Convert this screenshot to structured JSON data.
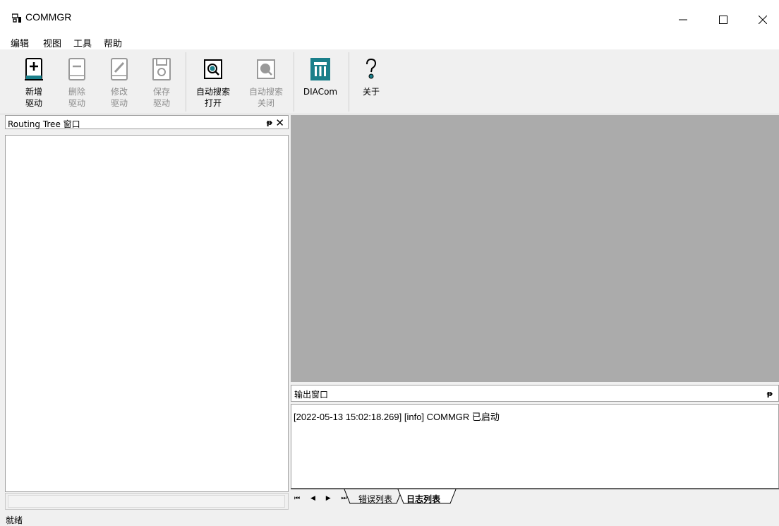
{
  "app": {
    "title": "COMMGR",
    "icon": "app-icon",
    "window_controls": {
      "minimize": "—",
      "maximize": "☐",
      "close": "✕"
    }
  },
  "menu": {
    "items": [
      "编辑",
      "视图",
      "工具",
      "帮助"
    ]
  },
  "toolbar": {
    "buttons": [
      {
        "line1": "新增",
        "line2": "驱动",
        "icon": "add-driver-icon",
        "enabled": true
      },
      {
        "line1": "删除",
        "line2": "驱动",
        "icon": "delete-driver-icon",
        "enabled": false
      },
      {
        "line1": "修改",
        "line2": "驱动",
        "icon": "edit-driver-icon",
        "enabled": false
      },
      {
        "line1": "保存",
        "line2": "驱动",
        "icon": "save-driver-icon",
        "enabled": false
      },
      {
        "line1": "自动搜索",
        "line2": "打开",
        "icon": "auto-search-open-icon",
        "enabled": true
      },
      {
        "line1": "自动搜索",
        "line2": "关闭",
        "icon": "auto-search-close-icon",
        "enabled": false
      },
      {
        "line1": "DIACom",
        "line2": "",
        "icon": "diacom-icon",
        "enabled": true
      },
      {
        "line1": "关于",
        "line2": "",
        "icon": "about-icon",
        "enabled": true
      }
    ],
    "accent": "#1a7f8a"
  },
  "routing_panel": {
    "title": "Routing Tree 窗口",
    "pin": "ᵽ",
    "close": "✕"
  },
  "output_panel": {
    "title": "输出窗口",
    "pin": "ᵽ",
    "log": [
      "[2022-05-13 15:02:18.269] [info] COMMGR 已启动"
    ],
    "nav": "⏮ ◀ ▶ ⏭",
    "tabs": [
      {
        "label": "错误列表",
        "active": false
      },
      {
        "label": "日志列表",
        "active": true
      }
    ]
  },
  "status": {
    "text": "就绪"
  },
  "colors": {
    "mdi_background": "#ababab",
    "chrome": "#f0f0f0"
  }
}
